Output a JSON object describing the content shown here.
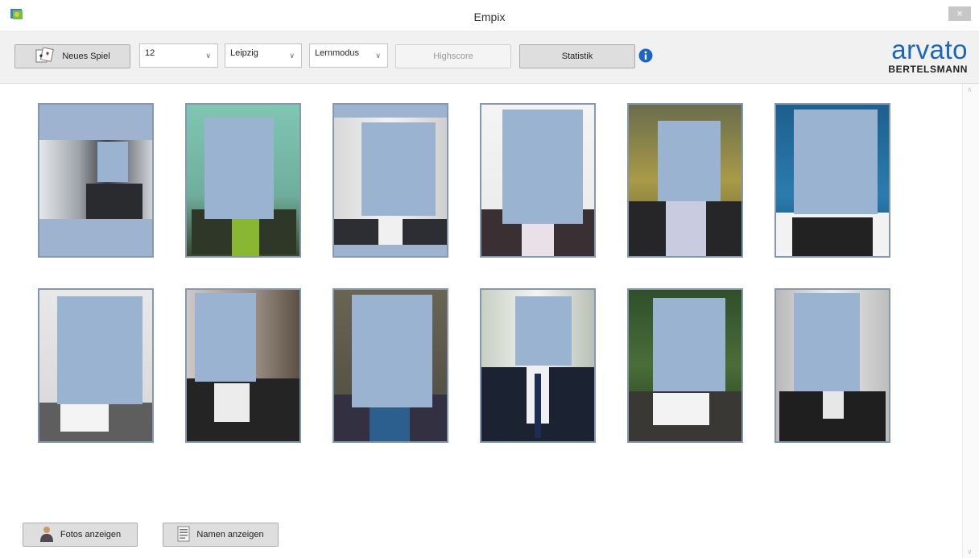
{
  "window": {
    "title": "Empix",
    "close_label": "×"
  },
  "toolbar": {
    "new_game_label": "Neues Spiel",
    "count_select": {
      "value": "12"
    },
    "location_select": {
      "value": "Leipzig"
    },
    "mode_select": {
      "value": "Lernmodus"
    },
    "highscore_label": "Highscore",
    "statistics_label": "Statistik"
  },
  "logo": {
    "brand": "arvato",
    "sub": "BERTELSMANN"
  },
  "bottom": {
    "show_photos_label": "Fotos anzeigen",
    "show_names_label": "Namen anzeigen"
  },
  "colors": {
    "accent": "#1a66b8",
    "card_border": "#8498b2",
    "face_mask": "#9ab3d1"
  }
}
